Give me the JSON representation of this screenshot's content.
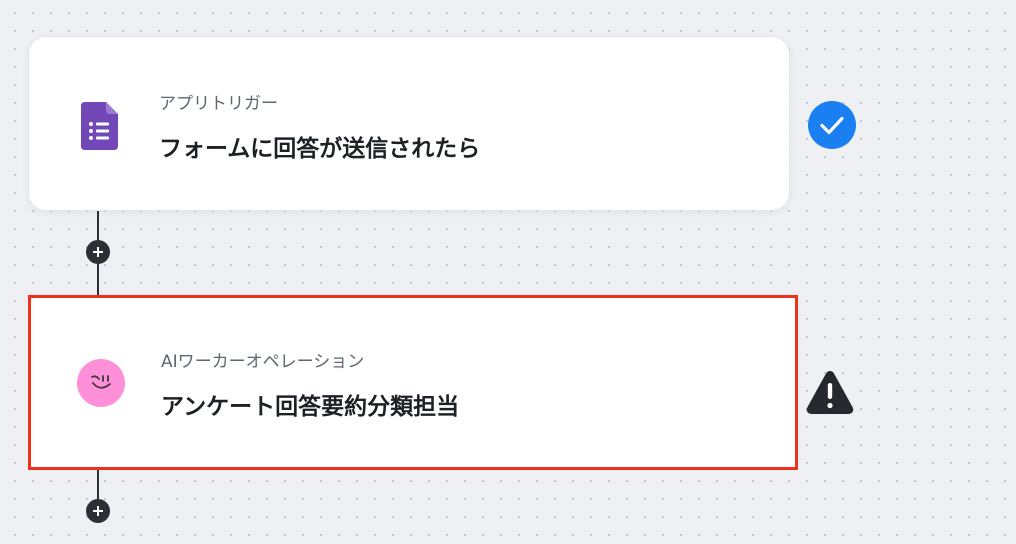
{
  "flow": {
    "steps": [
      {
        "type_label": "アプリトリガー",
        "title": "フォームに回答が送信されたら",
        "icon": "google-forms-icon",
        "status": "complete",
        "status_icon": "check-circle-icon",
        "status_color": "#1a7ff0",
        "icon_color": "#7248b9"
      },
      {
        "type_label": "AIワーカーオペレーション",
        "title": "アンケート回答要約分類担当",
        "icon": "smile-avatar-icon",
        "status": "warning",
        "status_icon": "warning-triangle-icon",
        "status_color": "#25282d",
        "icon_color": "#ff8fd9",
        "selected": true,
        "selection_color": "#f0311b"
      }
    ],
    "add_step_icon": "plus-icon"
  },
  "colors": {
    "canvas_background": "#eef0f3",
    "connector": "#2b2f36"
  }
}
